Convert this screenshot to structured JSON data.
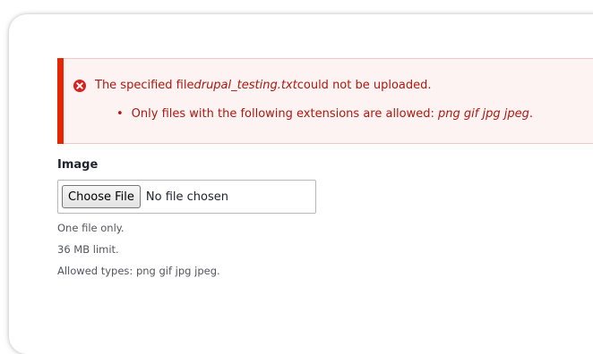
{
  "messages": {
    "error_prefix": "The specified file ",
    "error_filename": "drupal_testing.txt",
    "error_suffix": " could not be uploaded.",
    "detail_prefix": "Only files with the following extensions are allowed: ",
    "detail_extensions": "png gif jpg jpeg",
    "detail_suffix": ".",
    "bullet": "•",
    "icon": "error-x-icon",
    "accent_color": "#e62600",
    "text_color": "#b0170e"
  },
  "field": {
    "label": "Image",
    "button_label": "Choose File",
    "status": "No file chosen",
    "descriptions": [
      "One file only.",
      "36 MB limit.",
      "Allowed types: png gif jpg jpeg."
    ]
  }
}
